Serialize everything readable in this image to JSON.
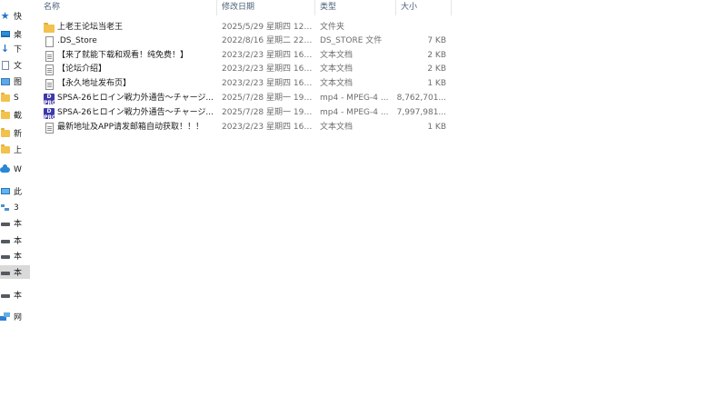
{
  "nav": {
    "items": [
      {
        "label": "快",
        "icon": "quick-access-star-icon"
      },
      {
        "label": "桌",
        "icon": "desktop-icon"
      },
      {
        "label": "下",
        "icon": "downloads-arrow-icon"
      },
      {
        "label": "文",
        "icon": "documents-icon"
      },
      {
        "label": "图",
        "icon": "pictures-icon"
      },
      {
        "label": "S",
        "icon": "folder-icon"
      },
      {
        "label": "截",
        "icon": "folder-icon"
      },
      {
        "label": "新",
        "icon": "folder-icon"
      },
      {
        "label": "上",
        "icon": "folder-icon"
      },
      {
        "label": "W",
        "icon": "onedrive-cloud-icon"
      },
      {
        "label": "此",
        "icon": "this-pc-icon"
      },
      {
        "label": "3",
        "icon": "network-objects-icon"
      },
      {
        "label": "本",
        "icon": "drive-icon"
      },
      {
        "label": "本",
        "icon": "drive-icon"
      },
      {
        "label": "本",
        "icon": "drive-icon"
      },
      {
        "label": "本",
        "icon": "drive-icon"
      },
      {
        "label": "本",
        "icon": "drive-icon"
      },
      {
        "label": "网",
        "icon": "network-icon"
      }
    ]
  },
  "columns": {
    "name": "名称",
    "date": "修改日期",
    "type": "类型",
    "size": "大小"
  },
  "files": [
    {
      "icon": "folder-icon",
      "name": "上老王论坛当老王",
      "date": "2025/5/29 星期四 12:...",
      "type": "文件夹",
      "size": ""
    },
    {
      "icon": "blank-file-icon",
      "name": ".DS_Store",
      "date": "2022/8/16 星期二 22:...",
      "type": "DS_STORE 文件",
      "size": "7 KB"
    },
    {
      "icon": "text-file-icon",
      "name": "【来了就能下载和观看！纯免费！】",
      "date": "2023/2/23 星期四 16:...",
      "type": "文本文档",
      "size": "2 KB"
    },
    {
      "icon": "text-file-icon",
      "name": "【论坛介绍】",
      "date": "2023/2/23 星期四 16:...",
      "type": "文本文档",
      "size": "2 KB"
    },
    {
      "icon": "text-file-icon",
      "name": "【永久地址发布页】",
      "date": "2023/2/23 星期四 16:...",
      "type": "文本文档",
      "size": "1 KB"
    },
    {
      "icon": "video-file-icon",
      "name": "SPSA-26ヒロイン戦力外通告～チャージ...",
      "date": "2025/7/28 星期一 19:...",
      "type": "mp4 - MPEG-4 ...",
      "size": "8,762,701..."
    },
    {
      "icon": "video-file-icon",
      "name": "SPSA-26ヒロイン戦力外通告～チャージ...",
      "date": "2025/7/28 星期一 19:...",
      "type": "mp4 - MPEG-4 ...",
      "size": "7,997,981..."
    },
    {
      "icon": "text-file-icon",
      "name": "最新地址及APP请发邮箱自动获取！！！",
      "date": "2023/2/23 星期四 16:...",
      "type": "文本文档",
      "size": "1 KB"
    }
  ],
  "video_icon_text": "D\nPRO",
  "colors": {
    "selection": "#d9d9d9",
    "header_text": "#4c607a",
    "folder": "#f2c14e",
    "accent": "#1e73c8"
  }
}
